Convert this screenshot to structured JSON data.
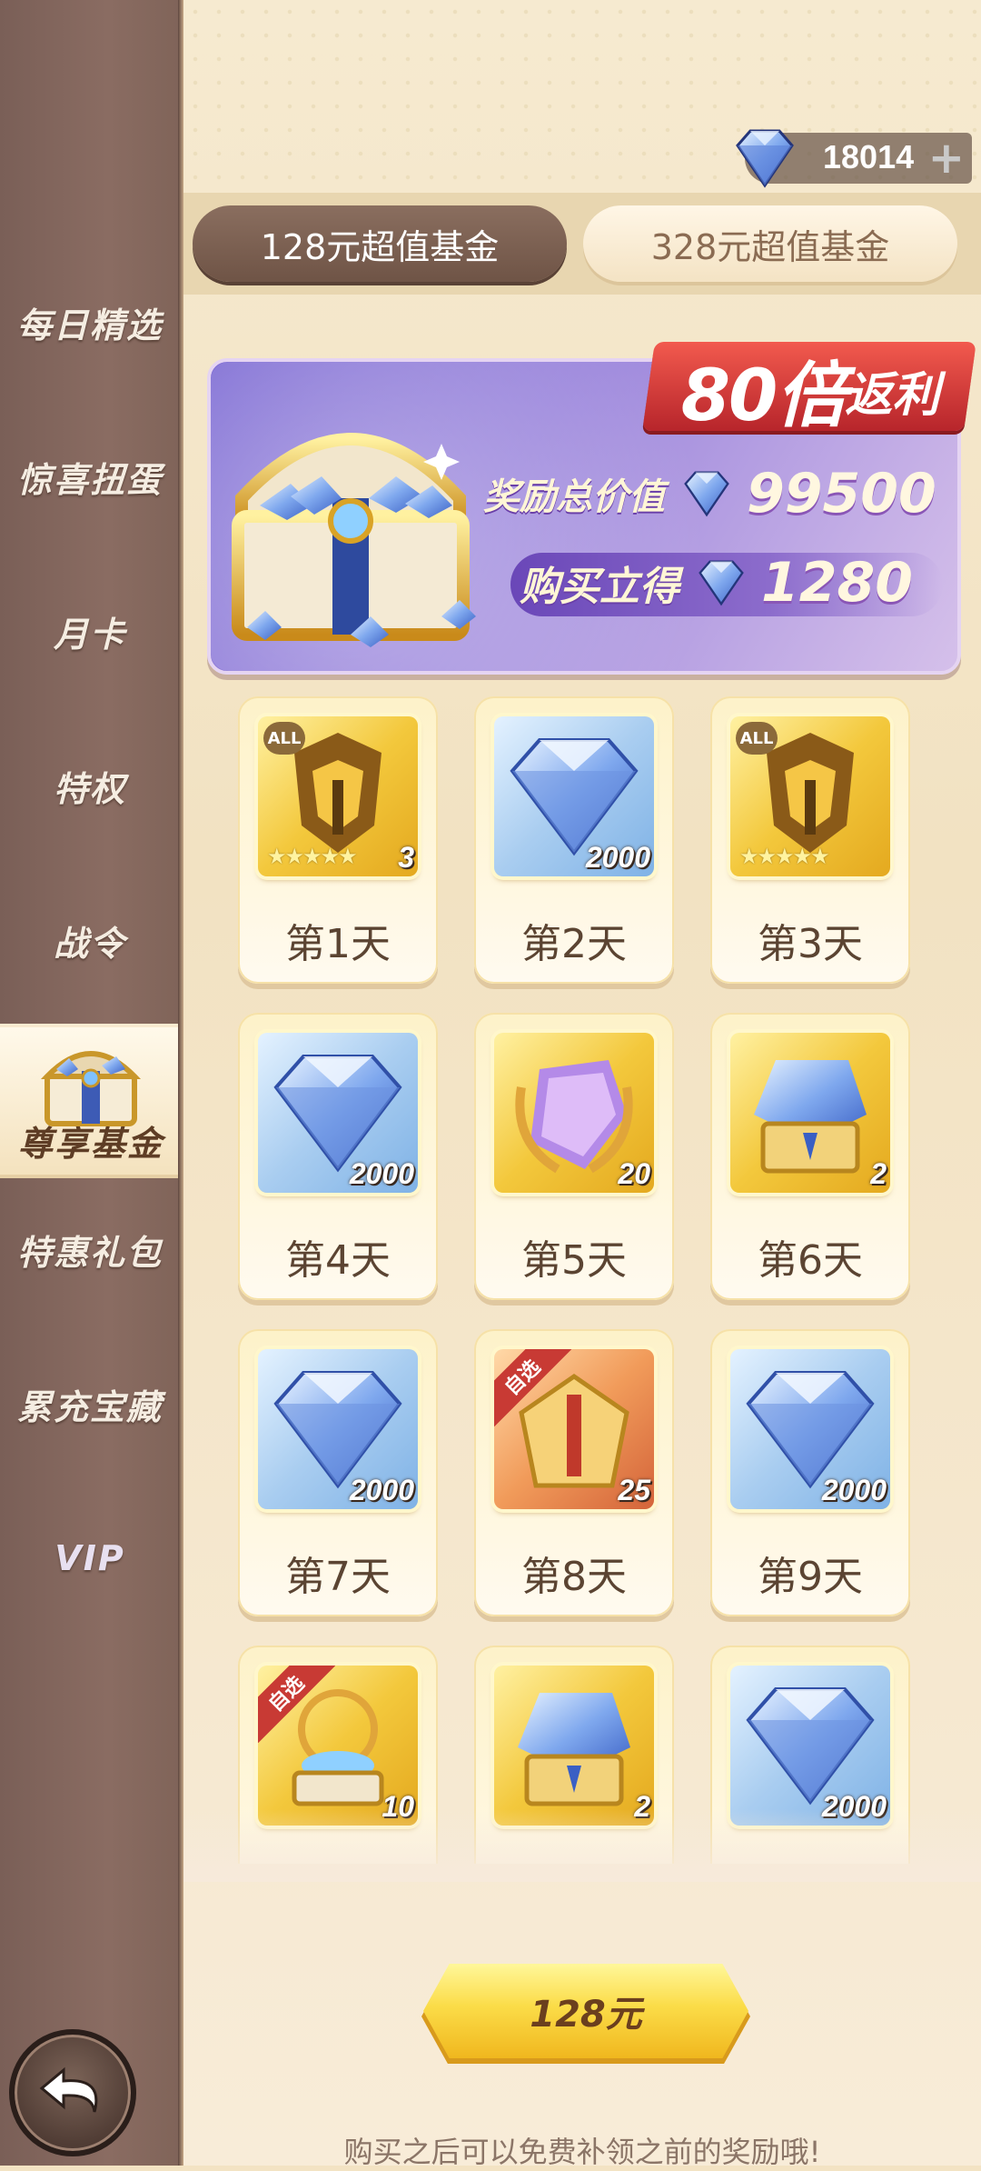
{
  "sidebar": {
    "items": [
      {
        "label": "每日精选"
      },
      {
        "label": "惊喜扭蛋"
      },
      {
        "label": "月卡"
      },
      {
        "label": "特权"
      },
      {
        "label": "战令"
      },
      {
        "label": "尊享基金"
      },
      {
        "label": "特惠礼包"
      },
      {
        "label": "累充宝藏"
      },
      {
        "label": "VIP"
      }
    ]
  },
  "currency": {
    "value": "18014",
    "plus": "+"
  },
  "tabs": [
    {
      "label": "128元超值基金"
    },
    {
      "label": "328元超值基金"
    }
  ],
  "banner": {
    "ribbon_big": "80倍",
    "ribbon_small": "返利",
    "total_label": "奖励总价值",
    "total_value": "99500",
    "instant_label": "购买立得",
    "instant_value": "1280"
  },
  "days": [
    {
      "label": "第1天",
      "count": "3",
      "icon": "hero-helmet-icon",
      "tag": "ALL",
      "style": "gold"
    },
    {
      "label": "第2天",
      "count": "2000",
      "icon": "diamond-icon",
      "tag": "",
      "style": "blue"
    },
    {
      "label": "第3天",
      "count": "",
      "icon": "hero-helmet-icon",
      "tag": "ALL",
      "style": "gold"
    },
    {
      "label": "第4天",
      "count": "2000",
      "icon": "diamond-icon",
      "tag": "",
      "style": "blue"
    },
    {
      "label": "第5天",
      "count": "20",
      "icon": "galaxy-crystal-icon",
      "tag": "",
      "style": "gold"
    },
    {
      "label": "第6天",
      "count": "2",
      "icon": "crystal-chest-icon",
      "tag": "",
      "style": "gold"
    },
    {
      "label": "第7天",
      "count": "2000",
      "icon": "diamond-icon",
      "tag": "",
      "style": "blue"
    },
    {
      "label": "第8天",
      "count": "25",
      "icon": "golden-armor-icon",
      "tag": "自选",
      "style": "red"
    },
    {
      "label": "第9天",
      "count": "2000",
      "icon": "diamond-icon",
      "tag": "",
      "style": "blue"
    },
    {
      "label": "",
      "count": "10",
      "icon": "orb-pedestal-icon",
      "tag": "自选",
      "style": "gold"
    },
    {
      "label": "",
      "count": "2",
      "icon": "crystal-chest-icon",
      "tag": "",
      "style": "gold"
    },
    {
      "label": "",
      "count": "2000",
      "icon": "diamond-icon",
      "tag": "",
      "style": "blue"
    }
  ],
  "buy": {
    "label": "128元"
  },
  "footnote": "购买之后可以免费补领之前的奖励哦!",
  "colors": {
    "accent_gold": "#f0b71e",
    "sidebar": "#7a5f57",
    "ribbon_red": "#c8302f",
    "banner_purple": "#8b77d8"
  }
}
